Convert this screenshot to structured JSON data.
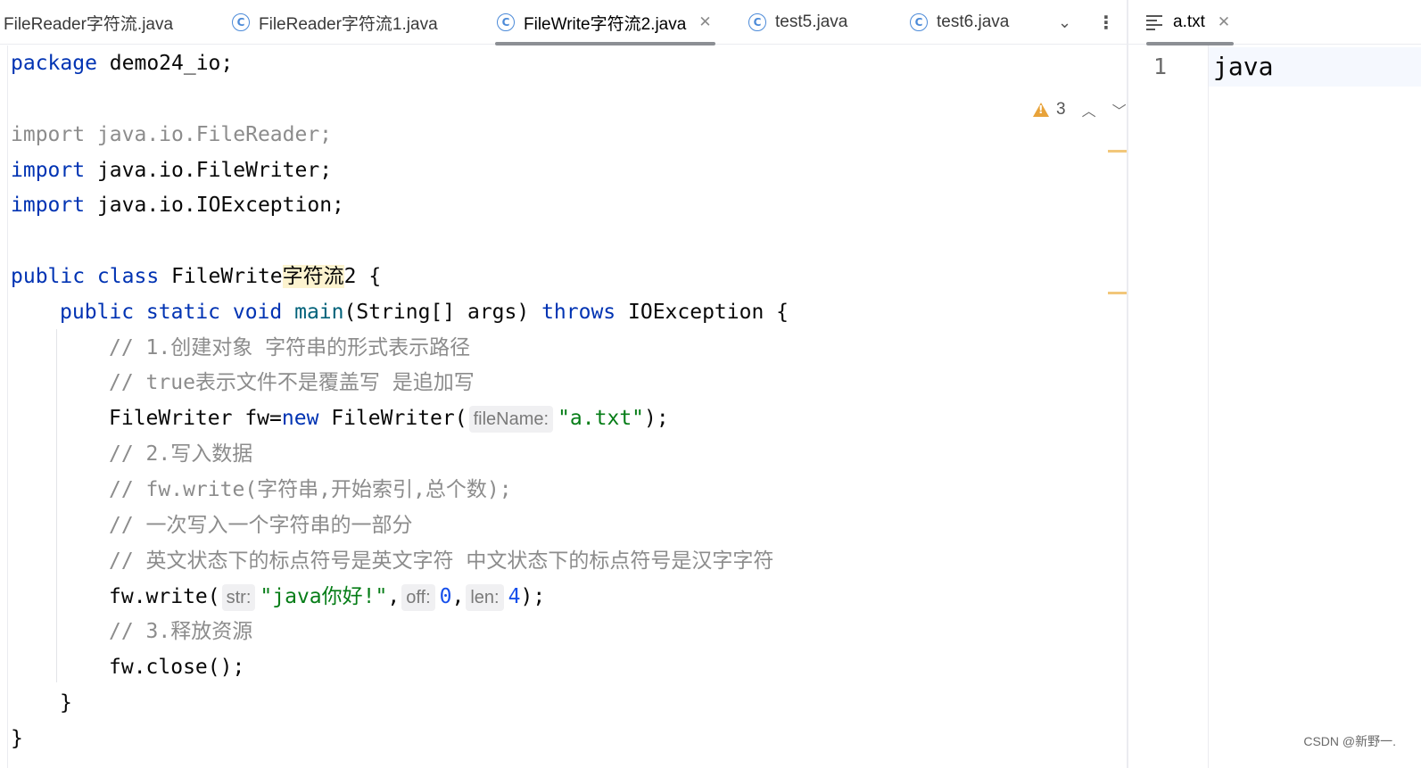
{
  "left_tabs": [
    {
      "label": "FileReader字符流.java",
      "icon": ""
    },
    {
      "label": "FileReader字符流1.java",
      "icon": "C"
    },
    {
      "label": "FileWrite字符流2.java",
      "icon": "C",
      "active": true
    },
    {
      "label": "test5.java",
      "icon": "C"
    },
    {
      "label": "test6.java",
      "icon": "C"
    }
  ],
  "right_tab": {
    "label": "a.txt",
    "icon": "text-file-icon"
  },
  "inspection": {
    "warning_count": "3"
  },
  "code": {
    "pkg_kw": "package",
    "pkg_name": " demo24_io;",
    "imp1": "import java.io.FileReader;",
    "imp2_kw": "import",
    "imp2_rest": " java.io.FileWriter;",
    "imp3_kw": "import",
    "imp3_rest": " java.io.IOException;",
    "class_kw": "public class",
    "class_name_a": " FileWrite",
    "class_name_hl": "字符流",
    "class_name_b": "2 {",
    "main_kw": "public static void",
    "main_name": " main",
    "main_params": "(String[] args) ",
    "main_throws": "throws",
    "main_tail": " IOException {",
    "cm1": "// 1.创建对象 字符串的形式表示路径",
    "cm2": "// true表示文件不是覆盖写 是追加写",
    "fw_a": "FileWriter fw=",
    "fw_new": "new",
    "fw_b": " FileWriter(",
    "fw_hint": "fileName:",
    "fw_str": "\"a.txt\"",
    "fw_end": ");",
    "cm3": "// 2.写入数据",
    "cm4": "// fw.write(字符串,开始索引,总个数);",
    "cm5": "// 一次写入一个字符串的一部分",
    "cm6": "// 英文状态下的标点符号是英文字符 中文状态下的标点符号是汉字字符",
    "write_a": "fw.write(",
    "write_hint1": "str:",
    "write_str": "\"java你好!\"",
    "write_comma1": ",",
    "write_hint2": "off:",
    "write_num1": "0",
    "write_comma2": ",",
    "write_hint3": "len:",
    "write_num2": "4",
    "write_end": ");",
    "cm7": "// 3.释放资源",
    "close": "fw.close();",
    "close_brace1": "}",
    "close_brace2": "}"
  },
  "right_editor": {
    "line_number": "1",
    "text": "java"
  },
  "watermark": "CSDN @新野一."
}
